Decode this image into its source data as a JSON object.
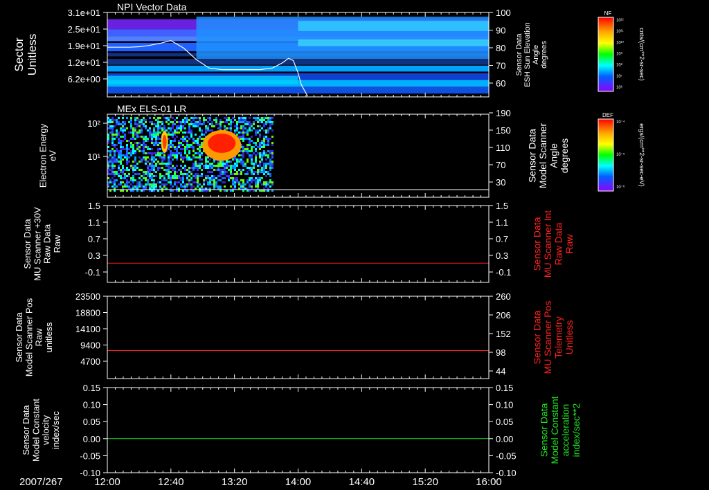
{
  "chart_data": [
    {
      "type": "heatmap",
      "title": "NPI Vector Data",
      "ylabel": "Sector\nUnitless",
      "yticks": [
        "3.1e+01",
        "2.5e+01",
        "1.9e+01",
        "1.2e+01",
        "6.2e+00"
      ],
      "y2label": "Sensor Data\nESH Sun Elevation\nAngle\ndegrees",
      "y2ticks": [
        "100",
        "90",
        "80",
        "70",
        "60"
      ],
      "colorbar": {
        "title": "NF",
        "unit": "cnts/(cm**2-sr-sec)",
        "ticks": [
          "10¹²",
          "10¹¹",
          "10¹⁰",
          "10⁹",
          "10⁸",
          "10⁷",
          "10⁶"
        ]
      },
      "overlay_line": {
        "name": "ESH Sun Elevation Angle",
        "color": "#ffffff",
        "x": [
          "12:00",
          "12:14",
          "12:20",
          "12:26",
          "12:34",
          "12:40",
          "12:48",
          "12:56",
          "13:04",
          "13:12",
          "13:20",
          "13:28",
          "13:36",
          "13:44",
          "13:50",
          "13:54",
          "13:57",
          "14:00",
          "14:02",
          "14:06"
        ],
        "y": [
          79.5,
          79.5,
          79.8,
          80.5,
          82,
          83.5,
          79,
          72,
          67,
          66,
          66,
          66,
          66,
          67,
          70,
          72.8,
          71.5,
          64,
          57,
          50
        ]
      }
    },
    {
      "type": "heatmap",
      "title": "MEx ELS-01 LR",
      "ylabel": "Electron Energy\neV",
      "yticks": [
        "10²",
        "10¹"
      ],
      "y2label": "Sensor Data\nModel Scanner\nAngle\ndegrees",
      "y2ticks": [
        "190",
        "150",
        "110",
        "70",
        "30"
      ],
      "colorbar": {
        "title": "DEF",
        "unit": "ergs/(cm**2-sr-sec-eV)",
        "ticks": [
          "10⁻⁴",
          "10⁻⁵",
          "10⁻⁶"
        ]
      },
      "data_end": "13:44"
    },
    {
      "type": "line",
      "ylabel": "Sensor Data\nMU Scanner +30V\nRaw Data\nRaw",
      "yticks": [
        "1.5",
        "1.1",
        "0.7",
        "0.3",
        "-0.1"
      ],
      "y2ticks": [
        "1.5",
        "1.1",
        "0.7",
        "0.3",
        "-0.1"
      ],
      "y2label": "Sensor Data\nMU Scanner Int\nRaw Data\nRaw",
      "ylim": [
        -0.5,
        1.5
      ],
      "series": [
        {
          "name": "MU Scanner Int Raw Data",
          "color": "#ff2020",
          "y": 0.0
        }
      ]
    },
    {
      "type": "line",
      "ylabel": "Sensor Data\nModel Scanner Pos\nRaw\nunitless",
      "yticks": [
        "23500",
        "18800",
        "14100",
        "9400",
        "4700"
      ],
      "y2ticks": [
        "260",
        "206",
        "152",
        "98",
        "44"
      ],
      "y2label": "Sensor Data\nMU Scanner Pos\nTelemetry\nUnitless",
      "ylim": [
        0,
        23500
      ],
      "series": [
        {
          "name": "MU Scanner Pos Telemetry",
          "color": "#ff2020",
          "y": 8000
        }
      ]
    },
    {
      "type": "line",
      "ylabel": "Sensor Data\nModel Constant\nvelocity\nindex/sec",
      "yticks": [
        "0.15",
        "0.10",
        "0.05",
        "0.00",
        "-0.05",
        "-0.10"
      ],
      "y2ticks": [
        "0.15",
        "0.10",
        "0.05",
        "0.00",
        "-0.05",
        "-0.10"
      ],
      "y2label": "Sensor Data\nModel Constant\nacceleration\nindex/sec**2",
      "ylim": [
        -0.1,
        0.15
      ],
      "series": [
        {
          "name": "Model Constant acceleration",
          "color": "#20e020",
          "y": 0.0
        }
      ]
    }
  ],
  "time_axis": {
    "date": "2007/267",
    "start": "12:00",
    "end": "16:00",
    "ticks": [
      "12:00",
      "12:40",
      "13:20",
      "14:00",
      "14:40",
      "15:20",
      "16:00"
    ]
  }
}
